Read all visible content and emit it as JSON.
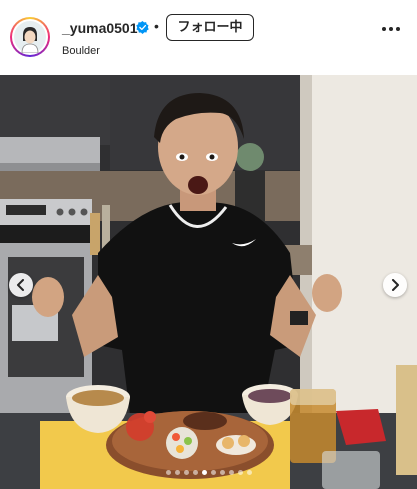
{
  "post": {
    "username": "_yuma0501",
    "separator": "•",
    "follow_label": "フォロー中",
    "location": "Boulder"
  },
  "icons": {
    "verified": "verified-badge-icon",
    "more": "more-options-icon",
    "prev": "chevron-left-icon",
    "next": "chevron-right-icon"
  },
  "carousel": {
    "total": 10,
    "active": 5
  },
  "colors": {
    "verified": "#0095f6",
    "text": "#262626",
    "tray": "#f0c64a",
    "shirt": "#111111",
    "wall": "#ede9e2"
  }
}
